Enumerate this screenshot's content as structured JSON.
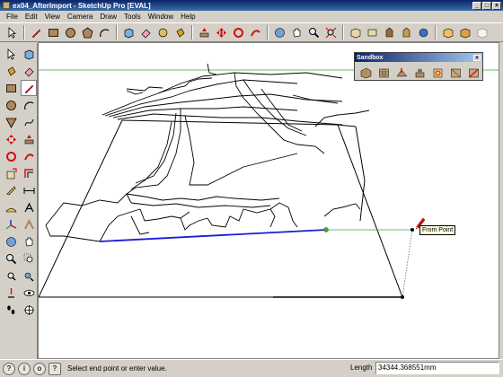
{
  "window": {
    "title": "ex04_AfterImport - SketchUp Pro [EVAL]",
    "min": "_",
    "max": "□",
    "close": "×"
  },
  "menu": [
    "File",
    "Edit",
    "View",
    "Camera",
    "Draw",
    "Tools",
    "Window",
    "Help"
  ],
  "toolbar": {
    "icons": [
      "select-icon",
      "line-icon",
      "rectangle-icon",
      "circle-icon",
      "arc-icon",
      "make-component-icon",
      "eraser-icon",
      "paint-bucket-icon",
      "push-pull-icon",
      "move-icon",
      "rotate-icon",
      "follow-me-icon",
      "orbit-icon",
      "pan-icon",
      "zoom-icon",
      "zoom-extents-icon",
      "iso-view-icon",
      "top-view-icon",
      "front-view-icon",
      "right-view-icon",
      "back-view-icon",
      "photo-textures-icon",
      "add-location-icon",
      "get-models-icon",
      "share-model-icon",
      "style-icon"
    ]
  },
  "sandbox": {
    "title": "Sandbox",
    "close": "×"
  },
  "viewport": {
    "tooltip": "From Point"
  },
  "status": {
    "hint": "Select end point or enter value.",
    "vcb_label": "Length",
    "vcb_value": "34344.368551mm"
  },
  "colors": {
    "axis_green": "#3aa83a",
    "axis_blue": "#1c1cd8",
    "pencil_red": "#d01010"
  }
}
